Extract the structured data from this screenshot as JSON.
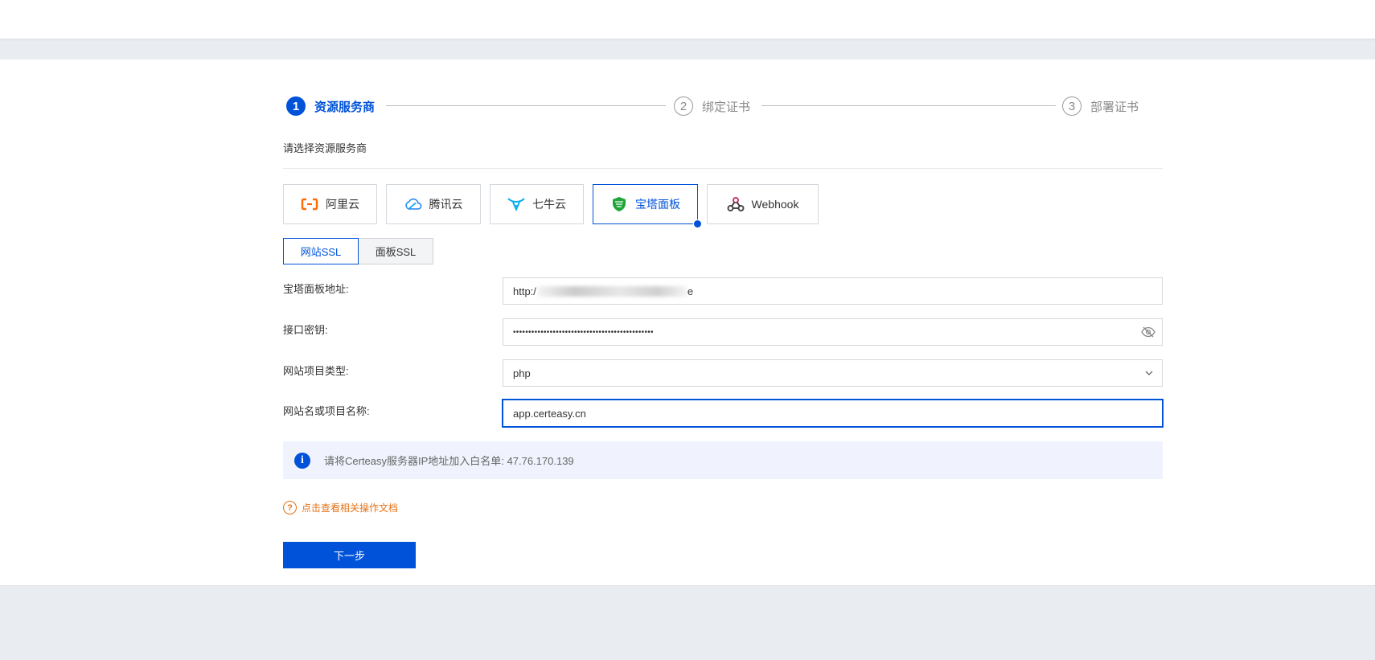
{
  "steps": [
    {
      "num": "1",
      "label": "资源服务商",
      "state": "active"
    },
    {
      "num": "2",
      "label": "绑定证书",
      "state": "idle"
    },
    {
      "num": "3",
      "label": "部署证书",
      "state": "idle"
    }
  ],
  "section_title": "请选择资源服务商",
  "providers": [
    {
      "label": "阿里云",
      "icon": "aliyun-icon"
    },
    {
      "label": "腾讯云",
      "icon": "tencent-cloud-icon"
    },
    {
      "label": "七牛云",
      "icon": "qiniu-icon"
    },
    {
      "label": "宝塔面板",
      "icon": "baota-icon",
      "selected": true
    },
    {
      "label": "Webhook",
      "icon": "webhook-icon"
    }
  ],
  "ssl_tabs": [
    {
      "label": "网站SSL",
      "active": true
    },
    {
      "label": "面板SSL",
      "active": false
    }
  ],
  "form": {
    "panel_address": {
      "label": "宝塔面板地址:",
      "value_prefix": "http:/",
      "value_suffix": "e"
    },
    "api_key": {
      "label": "接口密钥:",
      "value": "••••••••••••••••••••••••••••••••••••••••••••••"
    },
    "project_type": {
      "label": "网站项目类型:",
      "value": "php"
    },
    "site_name": {
      "label": "网站名或项目名称:",
      "value": "app.certeasy.cn"
    }
  },
  "notice": {
    "text": "请将Certeasy服务器IP地址加入白名单: 47.76.170.139"
  },
  "doc_link": {
    "icon_text": "?",
    "text": "点击查看相关操作文档"
  },
  "next_button": {
    "label": "下一步"
  },
  "colors": {
    "primary": "#0052d9",
    "warning": "#e37318",
    "notice_bg": "#f0f3fd"
  }
}
